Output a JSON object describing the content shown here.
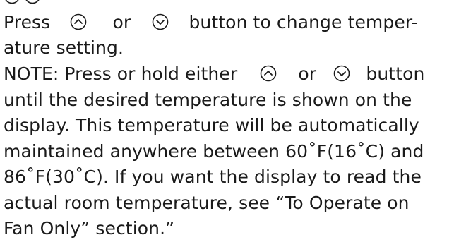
{
  "instruction": {
    "press": "Press",
    "or": "or",
    "rest_1": "button to change temper-",
    "rest_2": "ature setting."
  },
  "note": {
    "line_1_start": "NOTE: Press or hold either",
    "line_1_or": "or",
    "line_1_end": "button",
    "line_2": "until the desired temperature is shown on the",
    "line_3": "display. This temperature will be automatically",
    "line_4": "maintained anywhere between 60˚F(16˚C) and",
    "line_5": "86˚F(30˚C). If you want the display to read the",
    "line_6": "actual room temperature, see “To Operate on",
    "line_7": "Fan Only” section.”"
  },
  "icons": {
    "up": "up-button-icon",
    "down": "down-button-icon"
  },
  "colors": {
    "text": "#1a1a1a"
  }
}
